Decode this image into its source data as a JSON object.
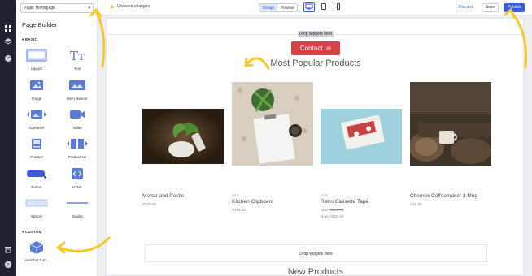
{
  "app": {
    "accent": "#3b5bdb",
    "rail_color": "#1f2330"
  },
  "rail": {
    "icons": [
      "grid-icon",
      "layers-icon",
      "palette-icon",
      "store-icon",
      "help-icon"
    ]
  },
  "sidebar": {
    "page_select": "Page: Homepage",
    "title": "Page Builder",
    "basic_label": "BASIC",
    "custom_label": "CUSTOM",
    "widgets": [
      {
        "label": "Layout",
        "icon": "layout-icon"
      },
      {
        "label": "Text",
        "icon": "text-icon"
      },
      {
        "label": "Image",
        "icon": "image-icon"
      },
      {
        "label": "Hero Banner",
        "icon": "hero-banner-icon"
      },
      {
        "label": "Carousel",
        "icon": "carousel-icon"
      },
      {
        "label": "Video",
        "icon": "video-icon"
      },
      {
        "label": "Product",
        "icon": "product-icon"
      },
      {
        "label": "Product set",
        "icon": "product-set-icon"
      },
      {
        "label": "Button",
        "icon": "button-icon",
        "chip": "button"
      },
      {
        "label": "HTML",
        "icon": "html-icon"
      },
      {
        "label": "Spacer",
        "icon": "spacer-icon"
      },
      {
        "label": "Divider",
        "icon": "divider-icon"
      }
    ],
    "custom_widgets": [
      {
        "label": "LiveChat Con...",
        "icon": "cube-icon"
      }
    ]
  },
  "toolbar": {
    "unsaved": "Unsaved changes",
    "design": "Design",
    "preview": "Preview",
    "discard": "Discard",
    "save": "Save",
    "publish": "Publish"
  },
  "canvas": {
    "drop_top": "Drop widgets here",
    "contact_button": "Contact us",
    "section_title": "Most Popular Products",
    "drop_bottom": "Drop widgets here",
    "next_title": "New Products",
    "products": [
      {
        "brand": "",
        "name": "Mortar and Pestle",
        "price": "zł225.00",
        "was": "",
        "now": ""
      },
      {
        "brand": "OFS",
        "name": "Kitchen Clipboard",
        "price": "zł119.00",
        "was": "",
        "now": ""
      },
      {
        "brand": "OFS",
        "name": "Retro Cassette Tape",
        "price": "",
        "was_label": "Was:",
        "was": "zł249.00",
        "now_label": "Now:",
        "now": "zł200.00"
      },
      {
        "brand": "",
        "name": "Chemex Coffeemaker 3 Mug",
        "price": "zł49.50",
        "was": "",
        "now": ""
      }
    ]
  }
}
